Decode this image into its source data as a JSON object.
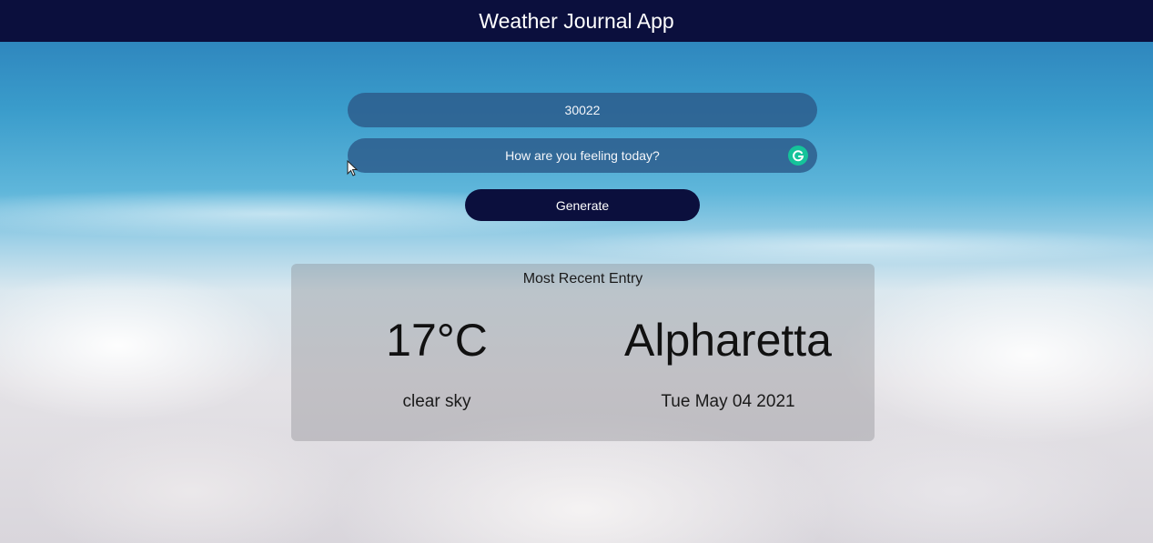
{
  "header": {
    "title": "Weather Journal App",
    "background_color": "#0b0f3d"
  },
  "form": {
    "zip_value": "30022",
    "feelings_placeholder": "How are you feeling today?",
    "extension_icon": "grammarly-icon",
    "generate_label": "Generate"
  },
  "entry": {
    "title": "Most Recent Entry",
    "temperature": "17°C",
    "city": "Alpharetta",
    "description": "clear sky",
    "date": "Tue May 04 2021"
  }
}
